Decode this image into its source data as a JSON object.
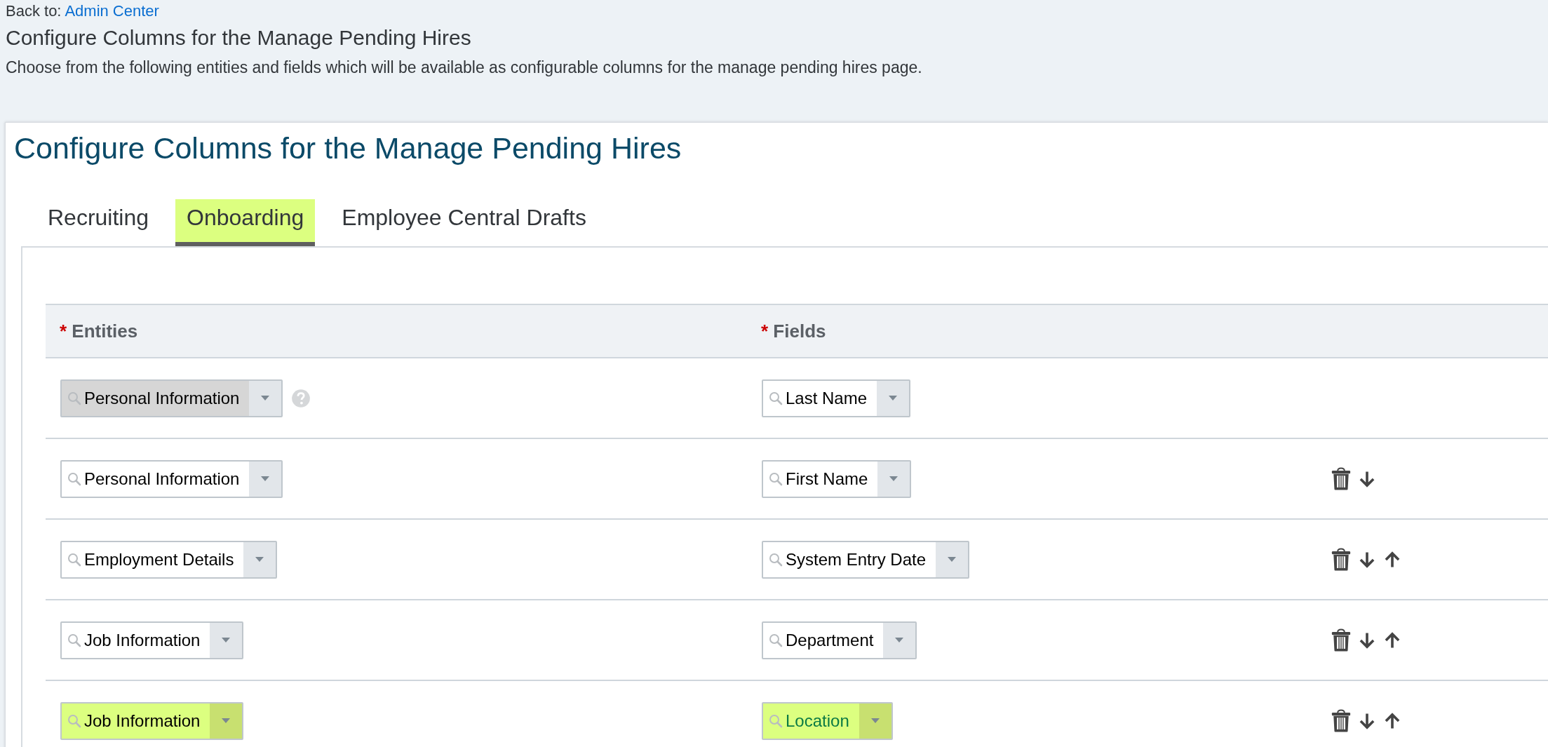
{
  "back": {
    "label": "Back to:",
    "link": "Admin Center"
  },
  "page_title": "Configure Columns for the Manage Pending Hires",
  "description": "Choose from the following entities and fields which will be available as configurable columns for the manage pending hires page.",
  "panel": {
    "title": "Configure Columns for the Manage Pending Hires",
    "tabs": [
      {
        "label": "Recruiting",
        "selected": false,
        "highlighted": false
      },
      {
        "label": "Onboarding",
        "selected": true,
        "highlighted": true
      },
      {
        "label": "Employee Central Drafts",
        "selected": false,
        "highlighted": false
      }
    ],
    "table": {
      "columns": [
        {
          "required_mark": "*",
          "label": "Entities"
        },
        {
          "required_mark": "*",
          "label": "Fields"
        }
      ],
      "rows": [
        {
          "entity": {
            "value": "Personal Information",
            "disabled": true,
            "highlighted": false
          },
          "help": true,
          "field": {
            "value": "Last Name",
            "highlighted": false
          },
          "actions": []
        },
        {
          "entity": {
            "value": "Personal Information",
            "disabled": false,
            "highlighted": false
          },
          "help": false,
          "field": {
            "value": "First Name",
            "highlighted": false
          },
          "actions": [
            {
              "kind": "delete"
            },
            {
              "kind": "down"
            }
          ]
        },
        {
          "entity": {
            "value": "Employment Details",
            "disabled": false,
            "highlighted": false
          },
          "help": false,
          "field": {
            "value": "System Entry Date",
            "highlighted": false
          },
          "actions": [
            {
              "kind": "delete"
            },
            {
              "kind": "down"
            },
            {
              "kind": "up"
            }
          ]
        },
        {
          "entity": {
            "value": "Job Information",
            "disabled": false,
            "highlighted": false
          },
          "help": false,
          "field": {
            "value": "Department",
            "highlighted": false
          },
          "actions": [
            {
              "kind": "delete"
            },
            {
              "kind": "down"
            },
            {
              "kind": "up"
            }
          ]
        },
        {
          "entity": {
            "value": "Job Information",
            "disabled": false,
            "highlighted": true
          },
          "help": false,
          "field": {
            "value": "Location",
            "highlighted": true
          },
          "actions": [
            {
              "kind": "delete"
            },
            {
              "kind": "down"
            },
            {
              "kind": "up"
            }
          ]
        }
      ]
    }
  }
}
